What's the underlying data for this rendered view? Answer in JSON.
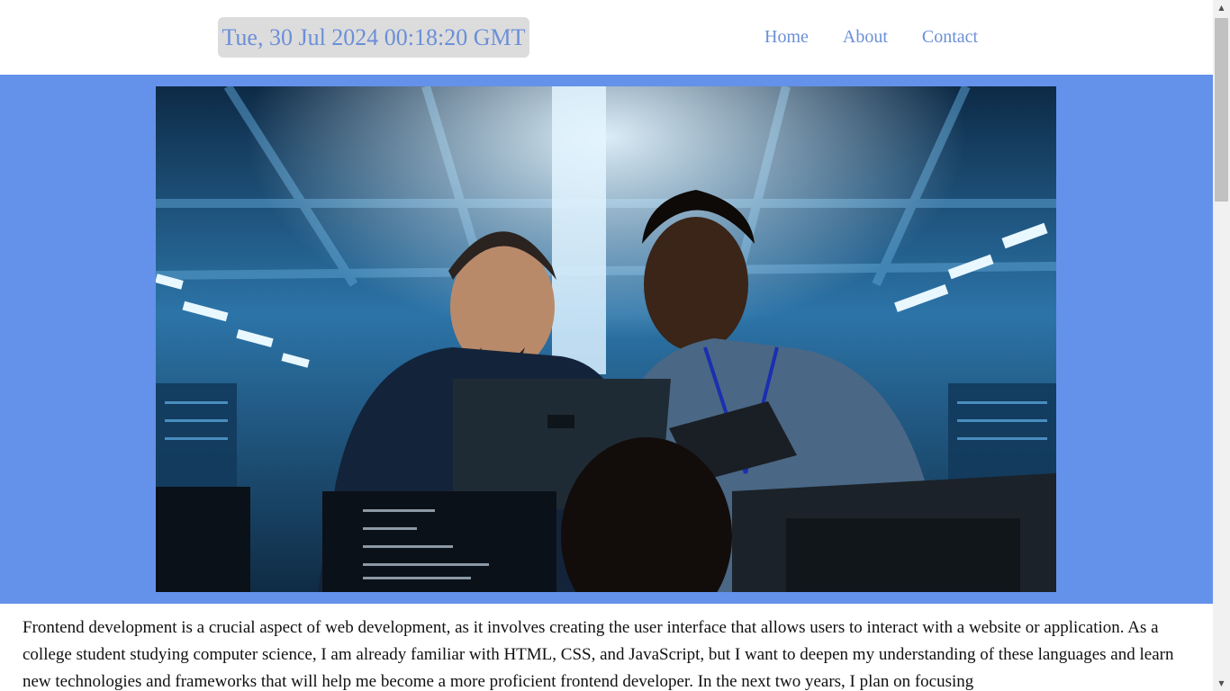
{
  "header": {
    "datetime": "Tue, 30 Jul 2024 00:18:20 GMT",
    "nav": {
      "home": "Home",
      "about": "About",
      "contact": "Contact"
    }
  },
  "hero": {
    "image_subject": "Two IT engineers looking at a laptop and tablet in a server room with code editors on monitors"
  },
  "content": {
    "paragraph": "Frontend development is a crucial aspect of web development, as it involves creating the user interface that allows users to interact with a website or application. As a college student studying computer science, I am already familiar with HTML, CSS, and JavaScript, but I want to deepen my understanding of these languages and learn new technologies and frameworks that will help me become a more proficient frontend developer. In the next two years, I plan on focusing"
  },
  "colors": {
    "accent": "#6b8fd8",
    "hero_bg": "#6491ea",
    "clock_bg": "#dcdcdc"
  }
}
